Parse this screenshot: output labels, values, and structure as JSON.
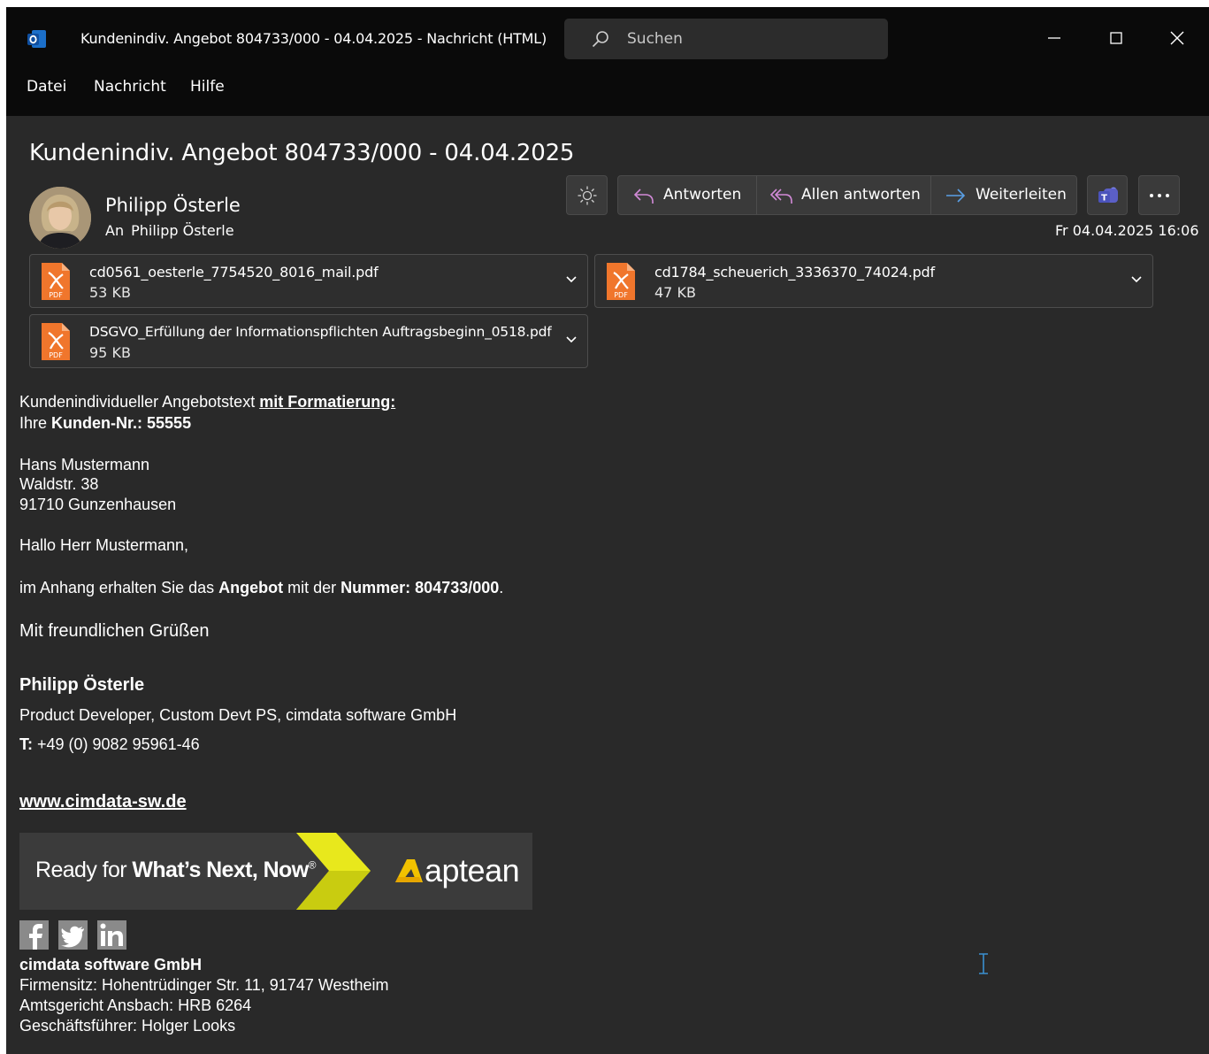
{
  "window": {
    "title": "Kundenindiv. Angebot 804733/000 - 04.04.2025  -  Nachricht (HTML)",
    "search_placeholder": "Suchen",
    "menu": [
      "Datei",
      "Nachricht",
      "Hilfe"
    ]
  },
  "header": {
    "subject": "Kundenindiv. Angebot 804733/000 - 04.04.2025",
    "sender": "Philipp Österle",
    "to_label": "An",
    "recipient": "Philipp Österle",
    "date": "Fr 04.04.2025 16:06",
    "actions": {
      "reply": "Antworten",
      "reply_all": "Allen antworten",
      "forward": "Weiterleiten"
    }
  },
  "attachments": [
    {
      "name": "cd0561_oesterle_7754520_8016_mail.pdf",
      "size": "53 KB"
    },
    {
      "name": "cd1784_scheuerich_3336370_74024.pdf",
      "size": "47 KB"
    },
    {
      "name": "DSGVO_Erfüllung der Informationspflichten Auftragsbeginn_0518.pdf",
      "size": "95 KB"
    }
  ],
  "message": {
    "intro_plain": "Kundenindividueller Angebotstext ",
    "intro_underlined": "mit Formatierung:",
    "customer_prefix": "Ihre ",
    "customer_label": "Kunden-Nr.: 55555",
    "address": [
      "Hans Mustermann",
      "Waldstr. 38",
      "91710 Gunzenhausen"
    ],
    "greeting": "Hallo Herr Mustermann,",
    "offer_1": "im Anhang erhalten Sie das ",
    "offer_2": "Angebot",
    "offer_3": " mit der ",
    "offer_4": "Nummer: 804733/000",
    "offer_5": ".",
    "closing": "Mit freundlichen Grüßen"
  },
  "signature": {
    "name": "Philipp Österle",
    "role": "Product Developer, Custom Devt PS, cimdata software GmbH",
    "phone_label": "T:",
    "phone": " +49 (0) 9082 95961-46",
    "website": "www.cimdata-sw.de",
    "banner_plain": "Ready for ",
    "banner_bold": "What’s Next, Now",
    "banner_reg": "®",
    "banner_logo": "aptean",
    "company": "cimdata software GmbH",
    "legal": [
      "Firmensitz: Hohentrüdinger Str. 11, 91747 Westheim",
      "Amtsgericht Ansbach: HRB 6264",
      "Geschäftsführer: Holger Looks"
    ]
  },
  "colors": {
    "window_bg": "#292929",
    "titlebar_bg": "#0a0a0a",
    "reply_icon": "#d28ad8",
    "forward_icon": "#5aa0e6",
    "banner_yellow": "#e6e61e",
    "pdf_orange": "#f0762c"
  }
}
